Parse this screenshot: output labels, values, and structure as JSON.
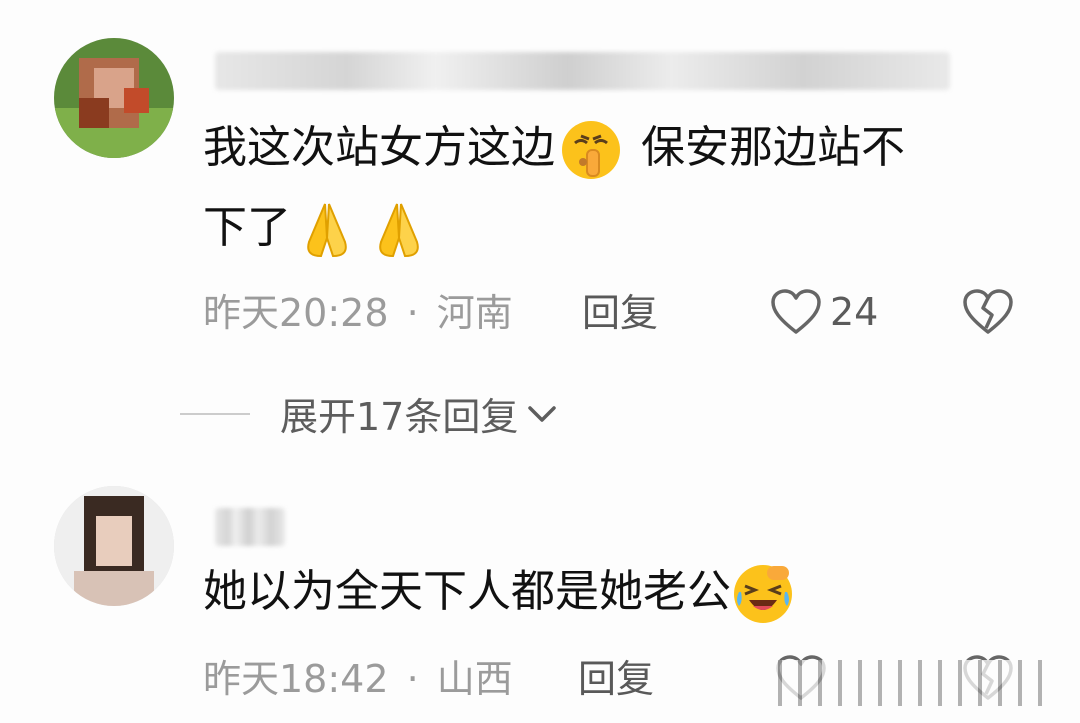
{
  "comments": [
    {
      "text_line1_a": "我这次站女方这边",
      "text_line1_b": "保安那边站不",
      "text_line2": "下了",
      "time": "昨天20:28",
      "sep": "·",
      "location": "河南",
      "reply": "回复",
      "likes": "24"
    },
    {
      "text_line1": "她以为全天下人都是她老公",
      "time": "昨天18:42",
      "sep": "·",
      "location": "山西",
      "reply": "回复"
    }
  ],
  "expand_replies": "展开17条回复",
  "icons": {
    "emoji1": "shushing-face-icon",
    "emoji2": "folded-hands-icon",
    "emoji3": "laughing-crying-face-icon",
    "like": "heart-outline-icon",
    "dislike": "broken-heart-icon",
    "expand": "chevron-down-icon"
  }
}
